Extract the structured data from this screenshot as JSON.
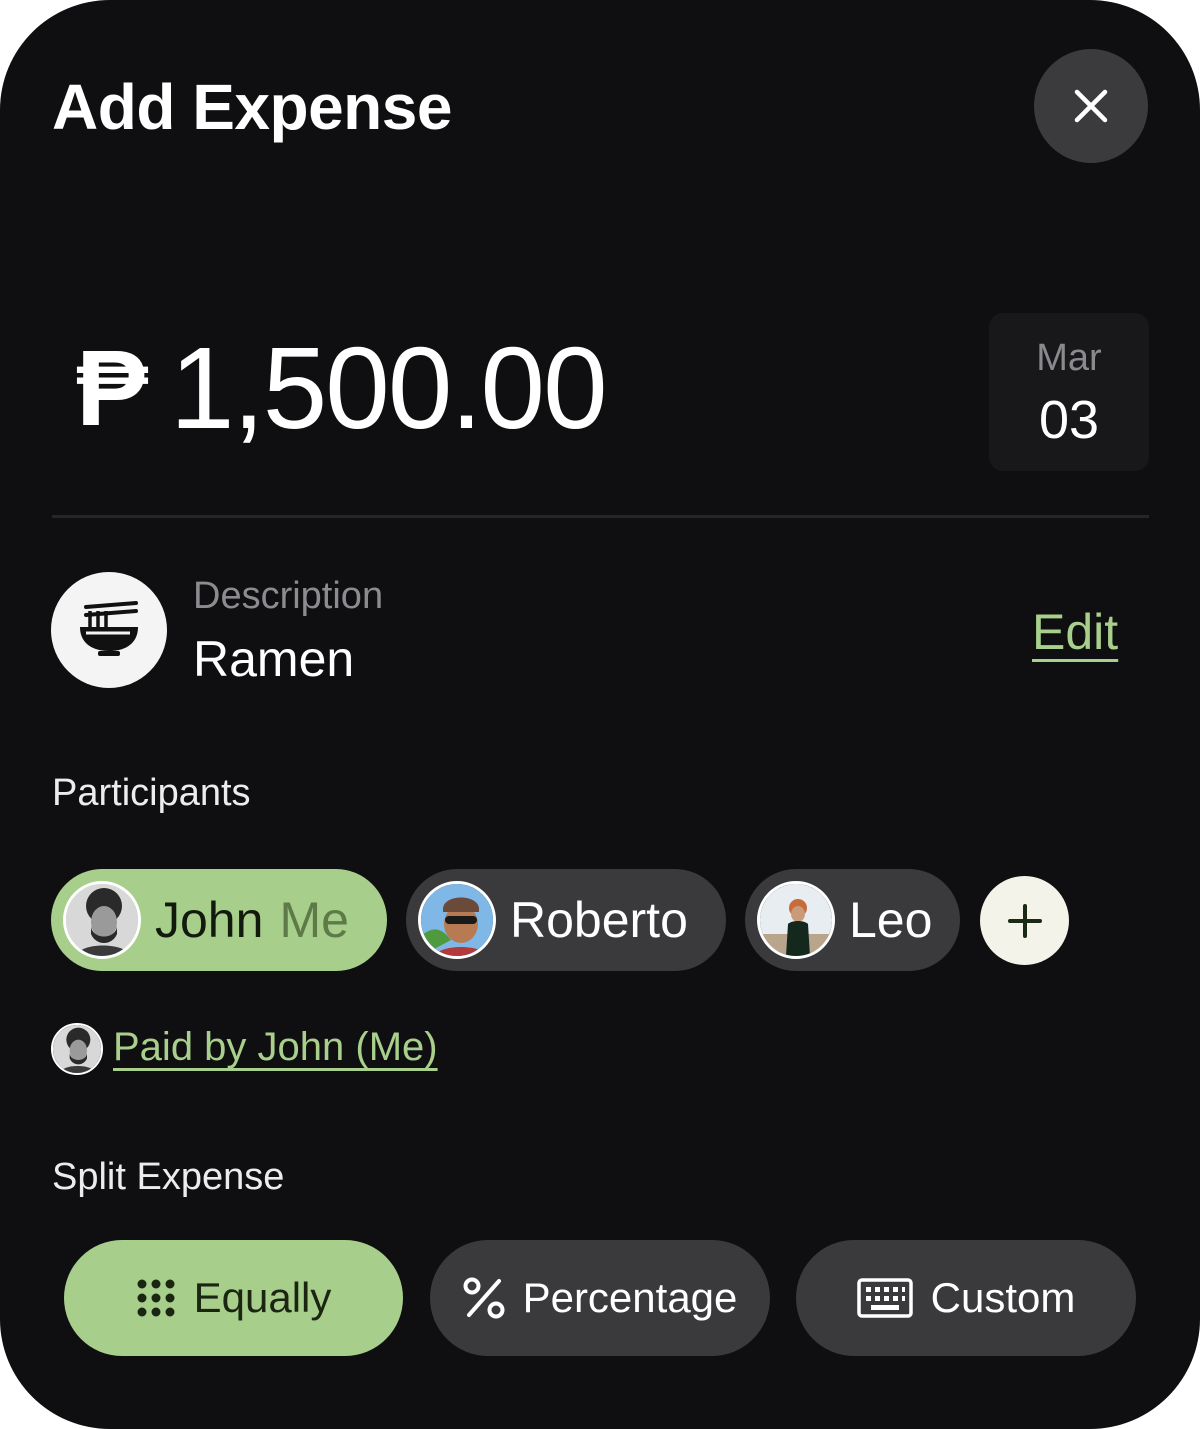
{
  "header": {
    "title": "Add Expense",
    "close_icon": "close-icon"
  },
  "amount": {
    "currency_symbol": "₱",
    "value": "1,500.00"
  },
  "date": {
    "month": "Mar",
    "day": "03"
  },
  "description": {
    "icon": "ramen-bowl-icon",
    "label": "Description",
    "value": "Ramen",
    "edit_label": "Edit"
  },
  "participants": {
    "label": "Participants",
    "items": [
      {
        "name": "John",
        "suffix": "Me",
        "selected": true
      },
      {
        "name": "Roberto",
        "selected": false
      },
      {
        "name": "Leo",
        "selected": false
      }
    ],
    "add_icon": "plus-icon"
  },
  "paid_by": {
    "text": "Paid by John (Me)"
  },
  "split": {
    "label": "Split Expense",
    "options": [
      {
        "label": "Equally",
        "icon": "dots-grid-icon",
        "selected": true
      },
      {
        "label": "Percentage",
        "icon": "percent-icon",
        "selected": false
      },
      {
        "label": "Custom",
        "icon": "keyboard-icon",
        "selected": false
      }
    ]
  },
  "colors": {
    "background": "#0f0f11",
    "accent": "#a7cf8b",
    "chip": "#3a3a3d",
    "link": "#a8cf8b"
  }
}
